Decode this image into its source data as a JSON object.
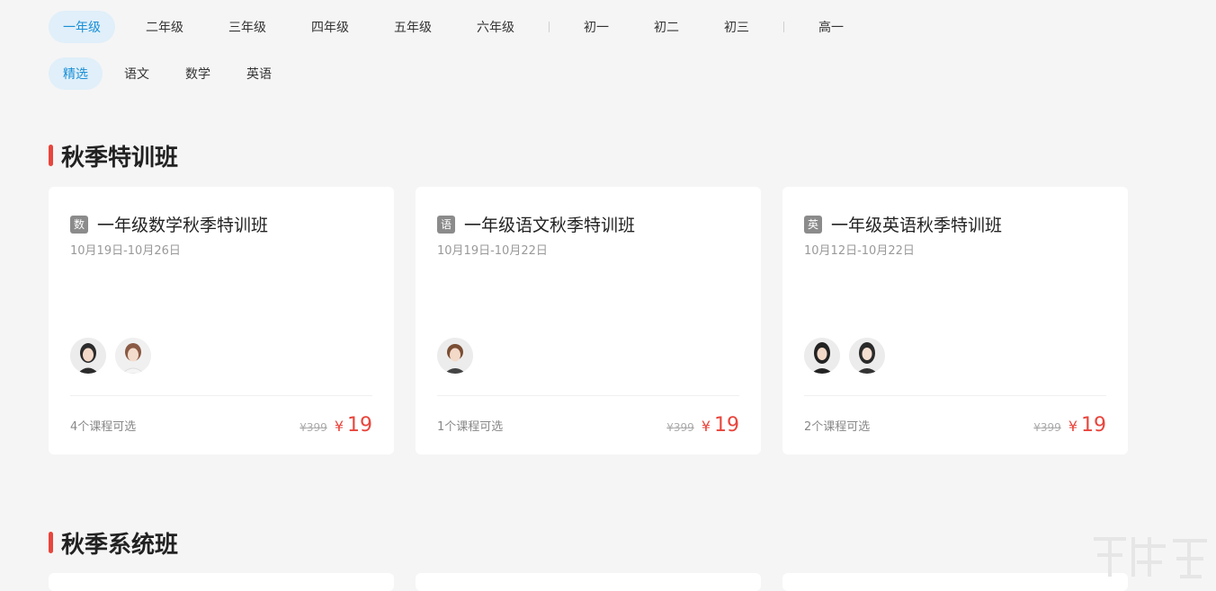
{
  "grades": {
    "primary": [
      "一年级",
      "二年级",
      "三年级",
      "四年级",
      "五年级",
      "六年级"
    ],
    "middle": [
      "初一",
      "初二",
      "初三"
    ],
    "high": [
      "高一"
    ],
    "active": "一年级"
  },
  "subjects": {
    "items": [
      "精选",
      "语文",
      "数学",
      "英语"
    ],
    "active": "精选"
  },
  "sections": [
    {
      "title": "秋季特训班",
      "cards": [
        {
          "tag": "数",
          "title": "一年级数学秋季特训班",
          "date": "10月19日-10月26日",
          "teachers": 2,
          "course_count": "4个课程可选",
          "original_price": "¥399",
          "currency": "¥",
          "price": "19"
        },
        {
          "tag": "语",
          "title": "一年级语文秋季特训班",
          "date": "10月19日-10月22日",
          "teachers": 1,
          "course_count": "1个课程可选",
          "original_price": "¥399",
          "currency": "¥",
          "price": "19"
        },
        {
          "tag": "英",
          "title": "一年级英语秋季特训班",
          "date": "10月12日-10月22日",
          "teachers": 2,
          "course_count": "2个课程可选",
          "original_price": "¥399",
          "currency": "¥",
          "price": "19"
        }
      ]
    },
    {
      "title": "秋季系统班"
    }
  ],
  "colors": {
    "accent": "#1a8fd6",
    "active_bg": "#e0eff9",
    "price": "#e8453c",
    "section_bar": "#e8453c"
  }
}
